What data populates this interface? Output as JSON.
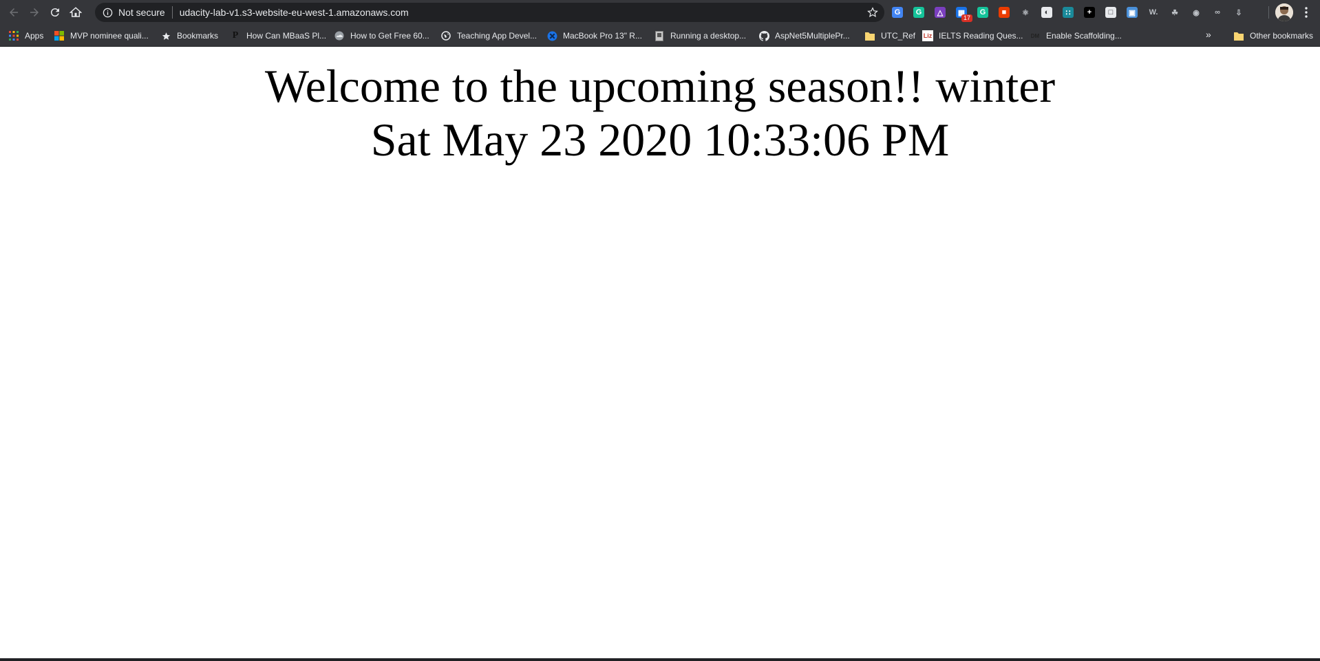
{
  "browser": {
    "omnibox": {
      "security_label": "Not secure",
      "url": "udacity-lab-v1.s3-website-eu-west-1.amazonaws.com"
    },
    "extensions": [
      {
        "icon": "translate-icon",
        "color": "#4285f4",
        "glyph": "G"
      },
      {
        "icon": "grammarly-icon",
        "color": "#15c39a",
        "glyph": "G"
      },
      {
        "icon": "visual-studio-icon",
        "color": "#7a3fbf",
        "glyph": "△"
      },
      {
        "icon": "calendar-icon",
        "color": "#1a73e8",
        "glyph": "▦",
        "badge": "17"
      },
      {
        "icon": "grammarly-check-icon",
        "color": "#15c39a",
        "glyph": "G"
      },
      {
        "icon": "office-icon",
        "color": "#eb3c00",
        "glyph": "■"
      },
      {
        "icon": "react-icon",
        "color": "#35363a",
        "glyph": "⚛"
      },
      {
        "icon": "clock-icon",
        "color": "#e8eaed",
        "glyph": "◐"
      },
      {
        "icon": "grid-icon",
        "color": "#1a8a9a",
        "glyph": "∷"
      },
      {
        "icon": "plus-icon",
        "color": "#000000",
        "glyph": "+"
      },
      {
        "icon": "page-icon",
        "color": "#e8eaed",
        "glyph": "□"
      },
      {
        "icon": "user-card-icon",
        "color": "#4a90d9",
        "glyph": "▣"
      },
      {
        "icon": "wordtune-icon",
        "color": "#35363a",
        "glyph": "W."
      },
      {
        "icon": "leaf-icon",
        "color": "#35363a",
        "glyph": "☘"
      },
      {
        "icon": "record-icon",
        "color": "#35363a",
        "glyph": "◉"
      },
      {
        "icon": "glasses-icon",
        "color": "#35363a",
        "glyph": "∞"
      },
      {
        "icon": "download-icon",
        "color": "#35363a",
        "glyph": "⇩"
      }
    ],
    "bookmarks": [
      {
        "label": "Apps",
        "icon": "apps-grid-icon"
      },
      {
        "label": "MVP nominee quali...",
        "icon": "microsoft-icon"
      },
      {
        "label": "Bookmarks",
        "icon": "star-bookmark-icon"
      },
      {
        "label": "How Can MBaaS Pl...",
        "icon": "p-site-icon"
      },
      {
        "label": "How to Get Free 60...",
        "icon": "cloud-site-icon"
      },
      {
        "label": "Teaching App Devel...",
        "icon": "globe-icon"
      },
      {
        "label": "MacBook Pro 13\" R...",
        "icon": "site-badge-icon"
      },
      {
        "label": "Running a desktop...",
        "icon": "document-icon"
      },
      {
        "label": "AspNet5MultiplePr...",
        "icon": "github-icon"
      },
      {
        "label": "UTC_Ref",
        "icon": "folder-icon"
      },
      {
        "label": "IELTS Reading Ques...",
        "icon": "liz-site-icon"
      },
      {
        "label": "Enable Scaffolding...",
        "icon": "dark-site-icon"
      }
    ],
    "bookmarks_overflow": "»",
    "other_bookmarks": "Other bookmarks",
    "colors": {
      "toolbar_bg": "#35363a",
      "omnibox_bg": "#202124",
      "text": "#e8eaed",
      "folder": "#f9d572"
    }
  },
  "page": {
    "greeting": "Welcome to the upcoming season!! winter",
    "datetime": "Sat May 23 2020 10:33:06 PM"
  }
}
